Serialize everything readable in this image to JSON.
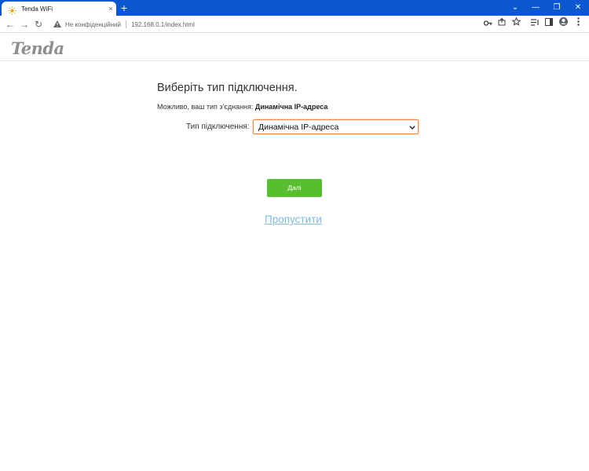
{
  "browser": {
    "tab_title": "Tenda WiFi",
    "tab_close": "×",
    "new_tab": "+",
    "window_controls": {
      "minimize": "—",
      "restore": "❐",
      "close": "✕",
      "dropdown": "⌄"
    },
    "nav": {
      "back": "←",
      "forward": "→",
      "reload": "↻"
    },
    "not_secure_label": "Не конфіденційний",
    "url": "192.168.0.1/index.html",
    "toolbar_icons": [
      "key-icon",
      "share-icon",
      "star-icon",
      "reading-list-icon",
      "side-panel-icon",
      "profile-icon",
      "menu-icon"
    ]
  },
  "header": {
    "logo_text": "Tenda"
  },
  "wizard": {
    "heading": "Виберіть тип підключення.",
    "detect_prefix": "Можливо, ваш тип з'єднання:",
    "detect_value": "Динамічна IP-адреса",
    "connection_label": "Тип підключення:",
    "connection_selected": "Динамічна IP-адреса",
    "next_label": "Далі",
    "skip_label": "Пропустити"
  },
  "colors": {
    "tabbar": "#0b57d0",
    "next_button": "#58bd2f",
    "skip_link": "#7fb8ea",
    "select_focus": "#f0883e"
  }
}
